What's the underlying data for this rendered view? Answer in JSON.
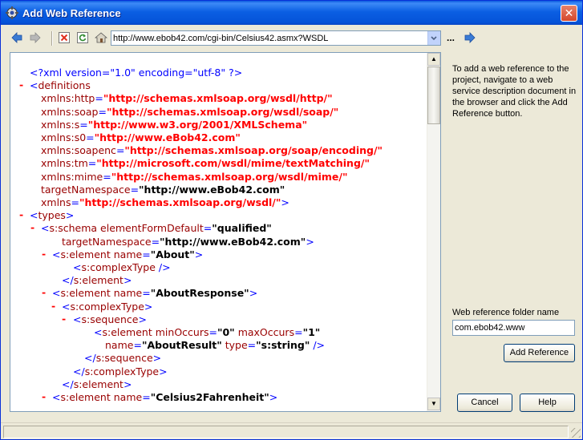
{
  "window": {
    "title": "Add Web Reference",
    "close_glyph": "✕"
  },
  "toolbar": {
    "icons": [
      "back-arrow-icon",
      "forward-arrow-icon",
      "stop-icon",
      "refresh-icon",
      "home-icon",
      "go-arrow-icon"
    ],
    "url": "http://www.ebob42.com/cgi-bin/Celsius42.asmx?WSDL",
    "ellipsis": "..."
  },
  "xml": {
    "lines": [
      [
        "",
        "<?xml version=\"1.0\" encoding=\"utf-8\" ?>"
      ],
      [
        "-",
        "<definitions"
      ],
      [
        "",
        "xmlns:http=\"http://schemas.xmlsoap.org/wsdl/http/\""
      ],
      [
        "",
        "xmlns:soap=\"http://schemas.xmlsoap.org/wsdl/soap/\""
      ],
      [
        "",
        "xmlns:s=\"http://www.w3.org/2001/XMLSchema\""
      ],
      [
        "",
        "xmlns:s0=\"http://www.eBob42.com\""
      ],
      [
        "",
        "xmlns:soapenc=\"http://schemas.xmlsoap.org/soap/encoding/\""
      ],
      [
        "",
        "xmlns:tm=\"http://microsoft.com/wsdl/mime/textMatching/\""
      ],
      [
        "",
        "xmlns:mime=\"http://schemas.xmlsoap.org/wsdl/mime/\""
      ],
      [
        "",
        "targetNamespace=\"http://www.eBob42.com\""
      ],
      [
        "",
        "xmlns=\"http://schemas.xmlsoap.org/wsdl/\">"
      ],
      [
        "-",
        "<types>"
      ],
      [
        "-",
        "<s:schema elementFormDefault=\"qualified\""
      ],
      [
        "",
        "targetNamespace=\"http://www.eBob42.com\">"
      ],
      [
        "-",
        "<s:element name=\"About\">"
      ],
      [
        "",
        "<s:complexType />"
      ],
      [
        "",
        "</s:element>"
      ],
      [
        "-",
        "<s:element name=\"AboutResponse\">"
      ],
      [
        "-",
        "<s:complexType>"
      ],
      [
        "-",
        "<s:sequence>"
      ],
      [
        "",
        "<s:element minOccurs=\"0\" maxOccurs=\"1\""
      ],
      [
        "",
        "name=\"AboutResult\" type=\"s:string\" />"
      ],
      [
        "",
        "</s:sequence>"
      ],
      [
        "",
        "</s:complexType>"
      ],
      [
        "",
        "</s:element>"
      ],
      [
        "-",
        "<s:element name=\"Celsius2Fahrenheit\">"
      ]
    ]
  },
  "side": {
    "help_text": "To add a web reference to the project, navigate to a web service description document in the browser and click the Add Reference button.",
    "folder_label": "Web reference folder name",
    "folder_value": "com.ebob42.www",
    "add_reference": "Add Reference",
    "cancel": "Cancel",
    "help": "Help"
  },
  "scrollbar": {
    "up_glyph": "▲",
    "down_glyph": "▼"
  },
  "colors": {
    "title_bar": "#0a5bde",
    "namespace_value": "#ff0000",
    "tag": "#990000",
    "punct": "#0000ff"
  }
}
